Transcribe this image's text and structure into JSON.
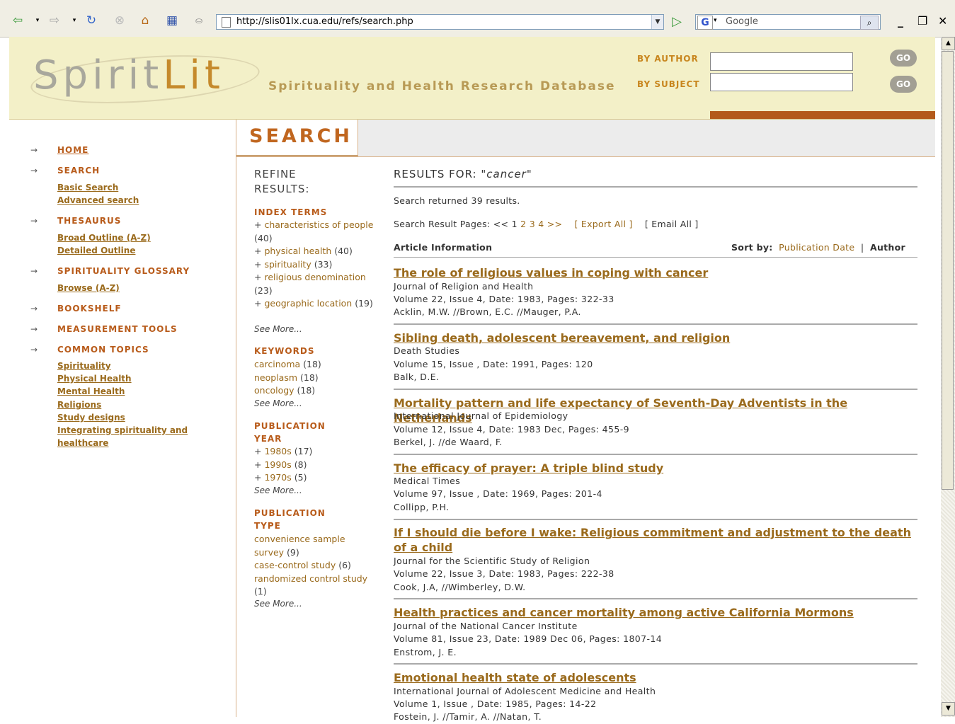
{
  "browser": {
    "url": "http://slis01lx.cua.edu/refs/search.php",
    "search_placeholder": "Google"
  },
  "header": {
    "logo_part1": "Spirit",
    "logo_part2": "Lit",
    "tagline": "Spirituality and Health Research Database",
    "by_author": "BY AUTHOR",
    "by_subject": "BY SUBJECT",
    "go": "GO"
  },
  "sidebar": {
    "home": "HOME",
    "search": "SEARCH",
    "basic_search": "Basic Search",
    "advanced_search": "Advanced search",
    "thesaurus": "THESAURUS",
    "broad_outline": "Broad Outline (A-Z)",
    "detailed_outline": "Detailed Outline",
    "glossary": "SPIRITUALITY GLOSSARY",
    "browse": "Browse (A-Z)",
    "bookshelf": "BOOKSHELF",
    "measurement": "MEASUREMENT TOOLS",
    "common_topics": "COMMON TOPICS",
    "topics": [
      "Spirituality",
      "Physical Health",
      "Mental Health",
      "Religions",
      "Study designs",
      "Integrating spirituality and",
      "healthcare"
    ]
  },
  "section_title": "SEARCH",
  "refine": {
    "title1": "REFINE",
    "title2": "RESULTS:",
    "index_terms": "INDEX TERMS",
    "keywords": "KEYWORDS",
    "pub_year1": "PUBLICATION",
    "pub_year2": "YEAR",
    "pub_type1": "PUBLICATION",
    "pub_type2": "TYPE",
    "see_more": "See More..."
  },
  "results": {
    "label": "RESULTS FOR:",
    "query": "cancer",
    "summary": "Search returned 39 results.",
    "pages_label": "Search Result Pages: << 1",
    "pages": [
      "2",
      "3",
      "4",
      ">>"
    ],
    "export_all": "[ Export All ]",
    "email_all": "[ Email All ]",
    "article_info": "Article Information",
    "sort_by": "Sort by:",
    "sort_date": "Publication Date",
    "sort_sep": "|",
    "sort_author": "Author"
  },
  "articles": [
    {
      "title": "The role of religious values in coping with cancer",
      "journal": "Journal of Religion and Health",
      "details": "Volume 22, Issue 4, Date: 1983, Pages: 322-33",
      "authors": "Acklin, M.W. //Brown, E.C. //Mauger, P.A."
    },
    {
      "title": "Sibling death, adolescent bereavement, and religion",
      "journal": "Death Studies",
      "details": "Volume 15, Issue , Date: 1991, Pages: 120",
      "authors": "Balk, D.E."
    },
    {
      "title": "Mortality pattern and life expectancy of Seventh-Day Adventists in the Netherlands",
      "journal": "International Journal of Epidemiology",
      "details": "Volume 12, Issue 4, Date: 1983 Dec, Pages: 455-9",
      "authors": "Berkel, J. //de Waard, F."
    },
    {
      "title": "The efficacy of prayer: A triple blind study",
      "journal": "Medical Times",
      "details": "Volume 97, Issue , Date: 1969, Pages: 201-4",
      "authors": "Collipp, P.H."
    },
    {
      "title": "If I should die before I wake: Religious commitment and adjustment to the death of a child",
      "journal": "Journal for the Scientific Study of Religion",
      "details": "Volume 22, Issue 3, Date: 1983, Pages: 222-38",
      "authors": "Cook, J.A, //Wimberley, D.W."
    },
    {
      "title": "Health practices and cancer mortality among active California Mormons",
      "journal": "Journal of the National Cancer Institute",
      "details": "Volume 81, Issue 23, Date: 1989 Dec 06, Pages: 1807-14",
      "authors": "Enstrom, J. E."
    },
    {
      "title": "Emotional health state of adolescents",
      "journal": "International Journal of Adolescent Medicine and Health",
      "details": "Volume 1, Issue , Date: 1985, Pages: 14-22",
      "authors": "Fostein, J. //Tamir, A. //Natan, T."
    }
  ],
  "colors": {
    "accent": "#c0661f",
    "link": "#9a6a1c",
    "header_bg": "#f3f0c8"
  }
}
